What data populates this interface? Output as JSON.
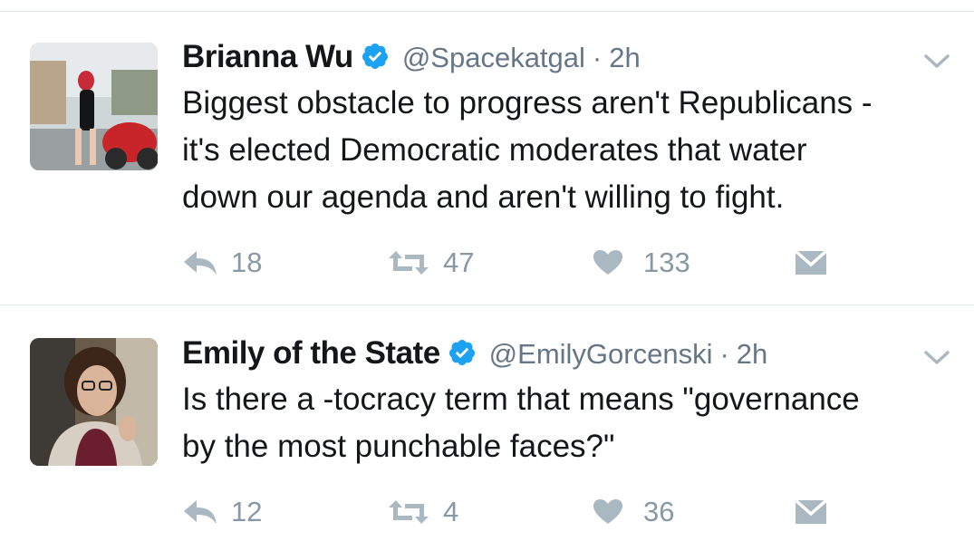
{
  "tweets": [
    {
      "name": "Brianna Wu",
      "handle": "@Spacekatgal",
      "separator": "·",
      "time": "2h",
      "text": "Biggest obstacle to progress aren't Republicans -\nit's elected Democratic moderates that water\ndown our agenda and aren't willing to fight.",
      "replies": "18",
      "retweets": "47",
      "likes": "133"
    },
    {
      "name": "Emily of the State",
      "handle": "@EmilyGorcenski",
      "separator": "·",
      "time": "2h",
      "text": "Is there a -tocracy term that means \"governance\nby the most punchable faces?\"",
      "replies": "12",
      "retweets": "4",
      "likes": "36"
    }
  ],
  "colors": {
    "verified": "#1da1f2",
    "secondary_text": "#657786",
    "action_icon": "#aab8c2",
    "divider": "#e1e8ed"
  },
  "icons": [
    "verified-badge-icon",
    "chevron-down-icon",
    "reply-icon",
    "retweet-icon",
    "heart-icon",
    "direct-message-icon"
  ]
}
